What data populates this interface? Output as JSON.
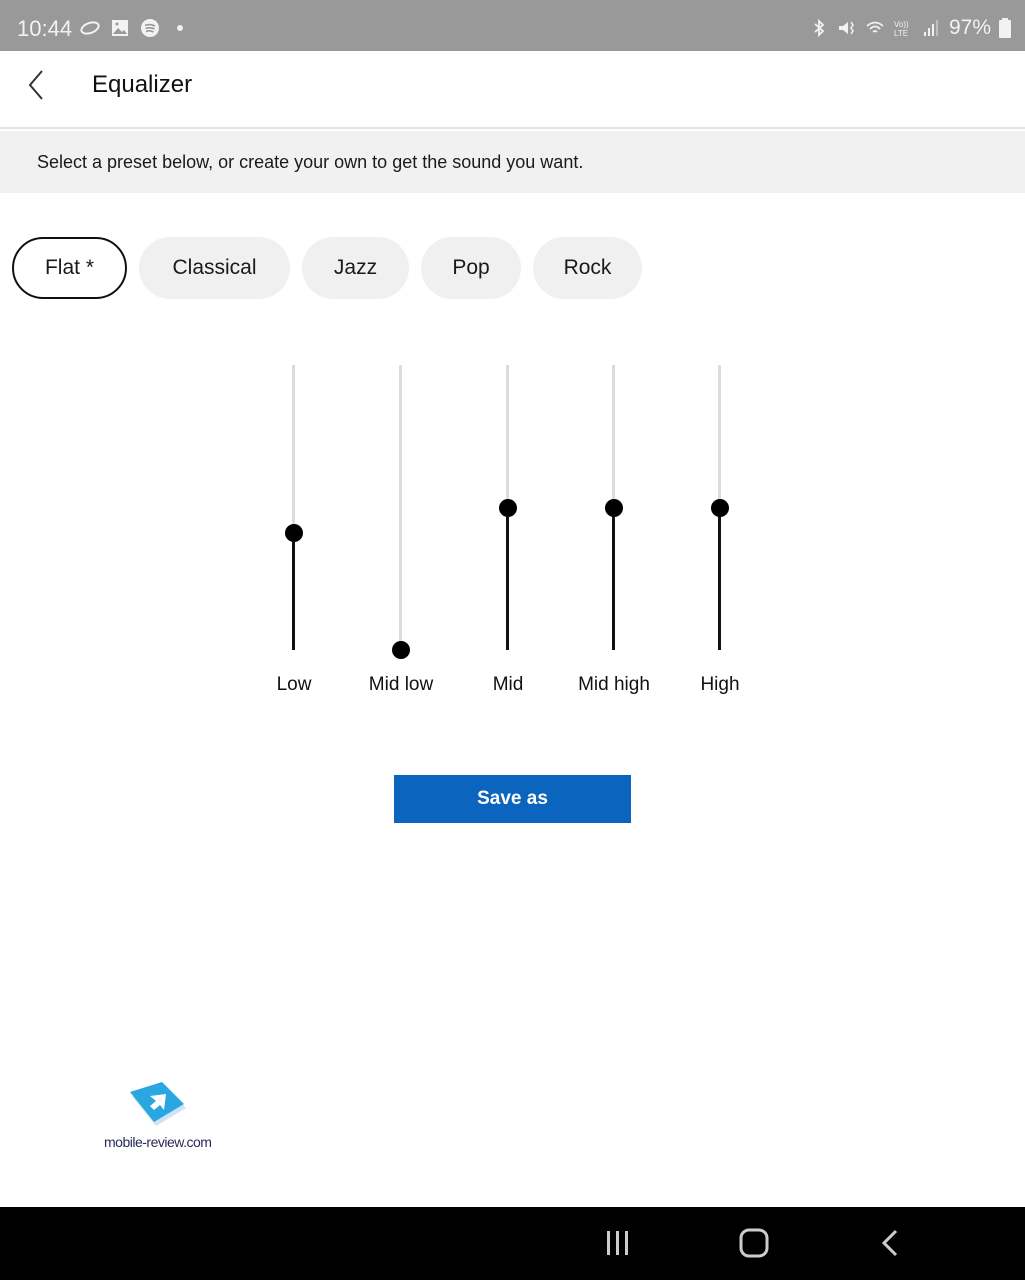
{
  "status_bar": {
    "time": "10:44",
    "left_icons": [
      "cloud-icon",
      "gallery-icon",
      "spotify-icon",
      "dot-icon"
    ],
    "right_icons": [
      "bluetooth-icon",
      "mute-vibrate-icon",
      "wifi-icon",
      "volte-icon",
      "signal-icon"
    ],
    "volte_label": "Vo)) LTE",
    "battery": "97%"
  },
  "app_bar": {
    "back_icon": "back-chevron-icon",
    "title": "Equalizer"
  },
  "info": {
    "text": "Select a preset below, or create your own to get the sound you want."
  },
  "presets": [
    {
      "label": "Flat *",
      "selected": true
    },
    {
      "label": "Classical",
      "selected": false
    },
    {
      "label": "Jazz",
      "selected": false
    },
    {
      "label": "Pop",
      "selected": false
    },
    {
      "label": "Rock",
      "selected": false
    }
  ],
  "equalizer": {
    "bands": [
      {
        "label": "Low",
        "level": 0.41
      },
      {
        "label": "Mid low",
        "level": 0.0
      },
      {
        "label": "Mid",
        "level": 0.5
      },
      {
        "label": "Mid high",
        "level": 0.5
      },
      {
        "label": "High",
        "level": 0.5
      }
    ]
  },
  "actions": {
    "save_as": "Save as"
  },
  "watermark": {
    "text": "mobile-review.com"
  },
  "nav_bar": {
    "buttons": [
      "recent-apps-icon",
      "home-icon",
      "back-icon"
    ]
  },
  "colors": {
    "accent": "#0b64bd",
    "status_bar": "#999999",
    "chip_bg": "#f0f0f0",
    "track": "#dcdcdc"
  }
}
